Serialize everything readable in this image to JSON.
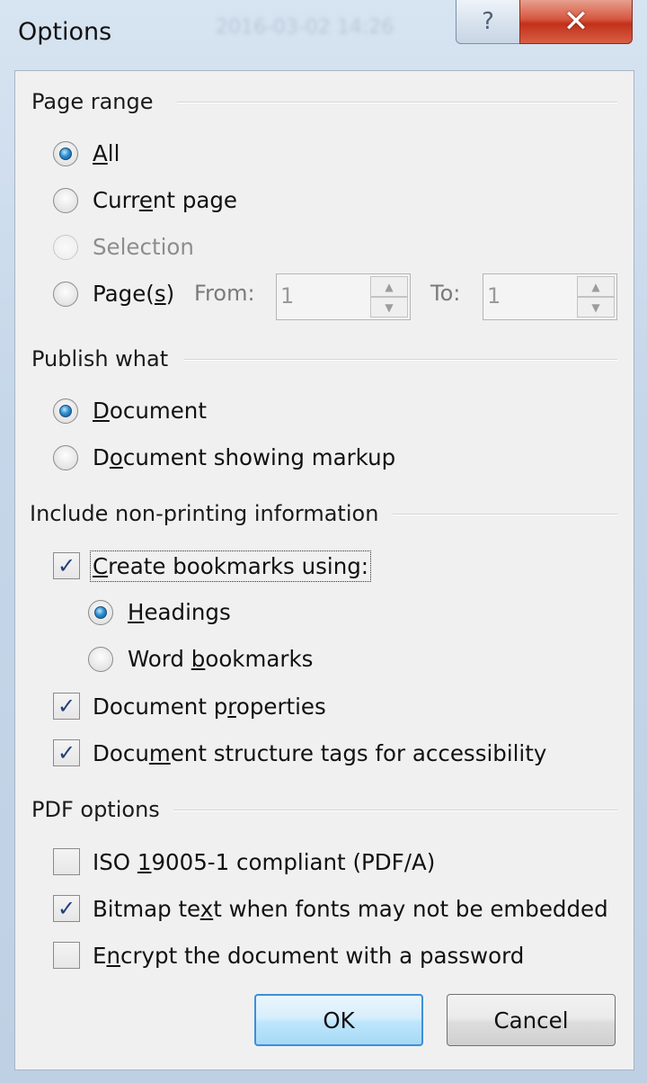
{
  "window": {
    "title": "Options",
    "background_text": "2016-03-02 14:26",
    "help_glyph": "?",
    "close_glyph": "✕"
  },
  "page_range": {
    "heading": "Page range",
    "all": {
      "pre": "",
      "key": "A",
      "post": "ll",
      "selected": true
    },
    "current_page": {
      "pre": "Curr",
      "key": "e",
      "post": "nt page",
      "selected": false
    },
    "selection": {
      "label": "Selection",
      "enabled": false
    },
    "pages": {
      "pre": "Page(",
      "key": "s",
      "post": ")",
      "selected": false
    },
    "from_label": "From:",
    "from_value": "1",
    "to_label": "To:",
    "to_value": "1"
  },
  "publish_what": {
    "heading": "Publish what",
    "document": {
      "pre": "",
      "key": "D",
      "post": "ocument",
      "selected": true
    },
    "document_markup": {
      "pre": "D",
      "key": "o",
      "post": "cument showing markup",
      "selected": false
    }
  },
  "non_printing": {
    "heading": "Include non-printing information",
    "create_bookmarks": {
      "pre": "",
      "key": "C",
      "post": "reate bookmarks using:",
      "checked": true
    },
    "headings": {
      "pre": "",
      "key": "H",
      "post": "eadings",
      "selected": true
    },
    "word_bookmarks": {
      "pre": "Word ",
      "key": "b",
      "post": "ookmarks",
      "selected": false
    },
    "doc_properties": {
      "pre": "Document p",
      "key": "r",
      "post": "operties",
      "checked": true
    },
    "structure_tags": {
      "pre": "Docu",
      "key": "m",
      "post": "ent structure tags for accessibility",
      "checked": true
    }
  },
  "pdf_options": {
    "heading": "PDF options",
    "iso": {
      "pre": "ISO ",
      "key": "1",
      "post": "9005-1 compliant (PDF/A)",
      "checked": false
    },
    "bitmap": {
      "pre": "Bitmap te",
      "key": "x",
      "post": "t when fonts may not be embedded",
      "checked": true
    },
    "encrypt": {
      "pre": "E",
      "key": "n",
      "post": "crypt the document with a password",
      "checked": false
    }
  },
  "buttons": {
    "ok": "OK",
    "cancel": "Cancel"
  },
  "check_glyph": "✓"
}
